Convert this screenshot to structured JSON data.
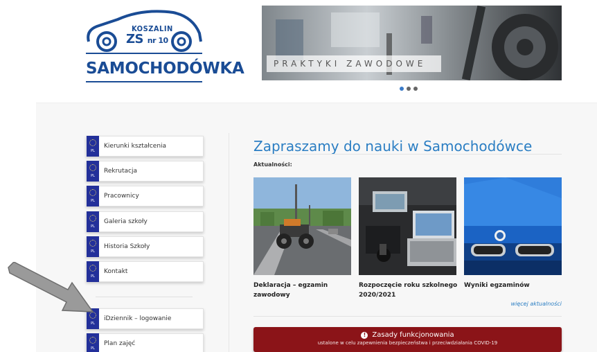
{
  "logo": {
    "city": "KOSZALIN",
    "school_prefix": "ZS",
    "school_suffix": "nr 10",
    "name": "SAMOCHODÓWKA"
  },
  "banner": {
    "caption": "PRAKTYKI ZAWODOWE",
    "slides": 3,
    "active_slide": 1
  },
  "sidebar": {
    "items": [
      {
        "label": "Kierunki kształcenia",
        "badge": "PL"
      },
      {
        "label": "Rekrutacja",
        "badge": "PL"
      },
      {
        "label": "Pracownicy",
        "badge": "PL"
      },
      {
        "label": "Galeria szkoły",
        "badge": "PL"
      },
      {
        "label": "Historia Szkoły",
        "badge": "PL"
      },
      {
        "label": "Kontakt",
        "badge": "PL"
      }
    ],
    "items2": [
      {
        "label": "iDziennik – logowanie",
        "badge": "PL"
      },
      {
        "label": "Plan zajęć",
        "badge": "PL"
      }
    ]
  },
  "main": {
    "heading": "Zapraszamy do nauki w Samochodówce",
    "news_label": "Aktualności:",
    "news": [
      {
        "title": "Deklaracja – egzamin zawodowy"
      },
      {
        "title": "Rozpoczęcie roku szkolnego 2020/2021"
      },
      {
        "title": "Wyniki egzaminów"
      }
    ],
    "more_link": "więcej aktualności"
  },
  "covid": {
    "title": "Zasady funkcjonowania",
    "subtitle": "ustalone w celu zapewnienia bezpieczeństwa i przeciwdziałania COVID-19",
    "icon": "info-icon"
  },
  "colors": {
    "accent": "#2b7ec3",
    "brand": "#1a4c95",
    "alert": "#8b1418",
    "eu_blue": "#23309a"
  }
}
